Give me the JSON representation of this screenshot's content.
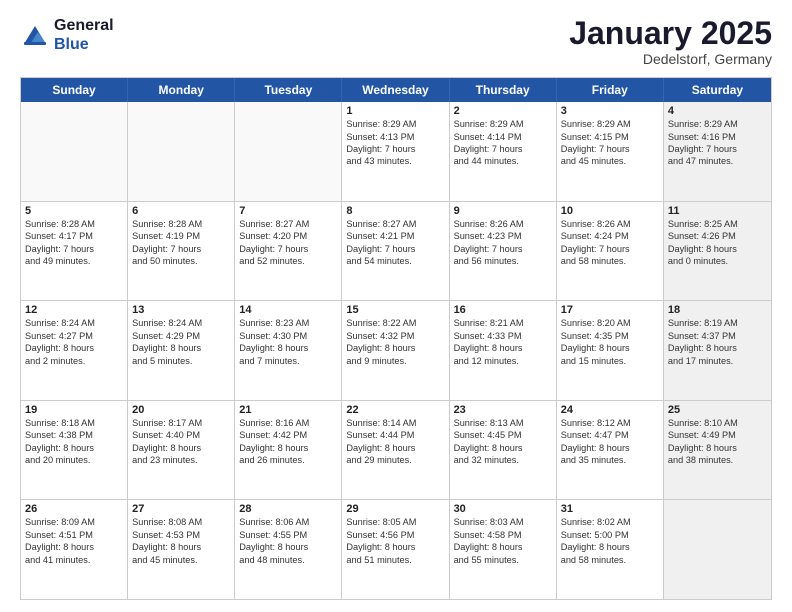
{
  "header": {
    "logo_general": "General",
    "logo_blue": "Blue",
    "month": "January 2025",
    "location": "Dedelstorf, Germany"
  },
  "days_of_week": [
    "Sunday",
    "Monday",
    "Tuesday",
    "Wednesday",
    "Thursday",
    "Friday",
    "Saturday"
  ],
  "weeks": [
    [
      {
        "day": "",
        "lines": [],
        "empty": true
      },
      {
        "day": "",
        "lines": [],
        "empty": true
      },
      {
        "day": "",
        "lines": [],
        "empty": true
      },
      {
        "day": "1",
        "lines": [
          "Sunrise: 8:29 AM",
          "Sunset: 4:13 PM",
          "Daylight: 7 hours",
          "and 43 minutes."
        ]
      },
      {
        "day": "2",
        "lines": [
          "Sunrise: 8:29 AM",
          "Sunset: 4:14 PM",
          "Daylight: 7 hours",
          "and 44 minutes."
        ]
      },
      {
        "day": "3",
        "lines": [
          "Sunrise: 8:29 AM",
          "Sunset: 4:15 PM",
          "Daylight: 7 hours",
          "and 45 minutes."
        ]
      },
      {
        "day": "4",
        "lines": [
          "Sunrise: 8:29 AM",
          "Sunset: 4:16 PM",
          "Daylight: 7 hours",
          "and 47 minutes."
        ],
        "shaded": true
      }
    ],
    [
      {
        "day": "5",
        "lines": [
          "Sunrise: 8:28 AM",
          "Sunset: 4:17 PM",
          "Daylight: 7 hours",
          "and 49 minutes."
        ]
      },
      {
        "day": "6",
        "lines": [
          "Sunrise: 8:28 AM",
          "Sunset: 4:19 PM",
          "Daylight: 7 hours",
          "and 50 minutes."
        ]
      },
      {
        "day": "7",
        "lines": [
          "Sunrise: 8:27 AM",
          "Sunset: 4:20 PM",
          "Daylight: 7 hours",
          "and 52 minutes."
        ]
      },
      {
        "day": "8",
        "lines": [
          "Sunrise: 8:27 AM",
          "Sunset: 4:21 PM",
          "Daylight: 7 hours",
          "and 54 minutes."
        ]
      },
      {
        "day": "9",
        "lines": [
          "Sunrise: 8:26 AM",
          "Sunset: 4:23 PM",
          "Daylight: 7 hours",
          "and 56 minutes."
        ]
      },
      {
        "day": "10",
        "lines": [
          "Sunrise: 8:26 AM",
          "Sunset: 4:24 PM",
          "Daylight: 7 hours",
          "and 58 minutes."
        ]
      },
      {
        "day": "11",
        "lines": [
          "Sunrise: 8:25 AM",
          "Sunset: 4:26 PM",
          "Daylight: 8 hours",
          "and 0 minutes."
        ],
        "shaded": true
      }
    ],
    [
      {
        "day": "12",
        "lines": [
          "Sunrise: 8:24 AM",
          "Sunset: 4:27 PM",
          "Daylight: 8 hours",
          "and 2 minutes."
        ]
      },
      {
        "day": "13",
        "lines": [
          "Sunrise: 8:24 AM",
          "Sunset: 4:29 PM",
          "Daylight: 8 hours",
          "and 5 minutes."
        ]
      },
      {
        "day": "14",
        "lines": [
          "Sunrise: 8:23 AM",
          "Sunset: 4:30 PM",
          "Daylight: 8 hours",
          "and 7 minutes."
        ]
      },
      {
        "day": "15",
        "lines": [
          "Sunrise: 8:22 AM",
          "Sunset: 4:32 PM",
          "Daylight: 8 hours",
          "and 9 minutes."
        ]
      },
      {
        "day": "16",
        "lines": [
          "Sunrise: 8:21 AM",
          "Sunset: 4:33 PM",
          "Daylight: 8 hours",
          "and 12 minutes."
        ]
      },
      {
        "day": "17",
        "lines": [
          "Sunrise: 8:20 AM",
          "Sunset: 4:35 PM",
          "Daylight: 8 hours",
          "and 15 minutes."
        ]
      },
      {
        "day": "18",
        "lines": [
          "Sunrise: 8:19 AM",
          "Sunset: 4:37 PM",
          "Daylight: 8 hours",
          "and 17 minutes."
        ],
        "shaded": true
      }
    ],
    [
      {
        "day": "19",
        "lines": [
          "Sunrise: 8:18 AM",
          "Sunset: 4:38 PM",
          "Daylight: 8 hours",
          "and 20 minutes."
        ]
      },
      {
        "day": "20",
        "lines": [
          "Sunrise: 8:17 AM",
          "Sunset: 4:40 PM",
          "Daylight: 8 hours",
          "and 23 minutes."
        ]
      },
      {
        "day": "21",
        "lines": [
          "Sunrise: 8:16 AM",
          "Sunset: 4:42 PM",
          "Daylight: 8 hours",
          "and 26 minutes."
        ]
      },
      {
        "day": "22",
        "lines": [
          "Sunrise: 8:14 AM",
          "Sunset: 4:44 PM",
          "Daylight: 8 hours",
          "and 29 minutes."
        ]
      },
      {
        "day": "23",
        "lines": [
          "Sunrise: 8:13 AM",
          "Sunset: 4:45 PM",
          "Daylight: 8 hours",
          "and 32 minutes."
        ]
      },
      {
        "day": "24",
        "lines": [
          "Sunrise: 8:12 AM",
          "Sunset: 4:47 PM",
          "Daylight: 8 hours",
          "and 35 minutes."
        ]
      },
      {
        "day": "25",
        "lines": [
          "Sunrise: 8:10 AM",
          "Sunset: 4:49 PM",
          "Daylight: 8 hours",
          "and 38 minutes."
        ],
        "shaded": true
      }
    ],
    [
      {
        "day": "26",
        "lines": [
          "Sunrise: 8:09 AM",
          "Sunset: 4:51 PM",
          "Daylight: 8 hours",
          "and 41 minutes."
        ]
      },
      {
        "day": "27",
        "lines": [
          "Sunrise: 8:08 AM",
          "Sunset: 4:53 PM",
          "Daylight: 8 hours",
          "and 45 minutes."
        ]
      },
      {
        "day": "28",
        "lines": [
          "Sunrise: 8:06 AM",
          "Sunset: 4:55 PM",
          "Daylight: 8 hours",
          "and 48 minutes."
        ]
      },
      {
        "day": "29",
        "lines": [
          "Sunrise: 8:05 AM",
          "Sunset: 4:56 PM",
          "Daylight: 8 hours",
          "and 51 minutes."
        ]
      },
      {
        "day": "30",
        "lines": [
          "Sunrise: 8:03 AM",
          "Sunset: 4:58 PM",
          "Daylight: 8 hours",
          "and 55 minutes."
        ]
      },
      {
        "day": "31",
        "lines": [
          "Sunrise: 8:02 AM",
          "Sunset: 5:00 PM",
          "Daylight: 8 hours",
          "and 58 minutes."
        ]
      },
      {
        "day": "",
        "lines": [],
        "empty": true,
        "shaded": true
      }
    ]
  ]
}
